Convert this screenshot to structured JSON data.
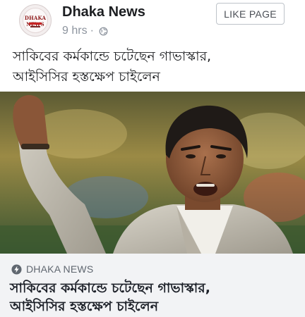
{
  "header": {
    "page_name": "Dhaka News",
    "timestamp": "9 hrs",
    "separator": "·",
    "avatar_logo_text": "DHAKA NEWS",
    "like_button_label": "LIKE PAGE"
  },
  "post": {
    "caption_line1": "সাকিবের কর্মকান্ডে চটেছেন গাভাস্কার,",
    "caption_line2": "আইসিসির হস্তক্ষেপ চাইলেন"
  },
  "link_preview": {
    "source": "DHAKA NEWS",
    "title_line1": "সাকিবের কর্মকান্ডে চটেছেন গাভাস্কার,",
    "title_line2": "আইসিসির হস্তক্ষেপ চাইলেন"
  },
  "icons": {
    "privacy": "globe-icon",
    "source": "bolt-circle-icon"
  },
  "colors": {
    "link_box_bg": "#f2f3f5",
    "meta_text": "#8d949e",
    "button_border": "#bec3c9"
  }
}
